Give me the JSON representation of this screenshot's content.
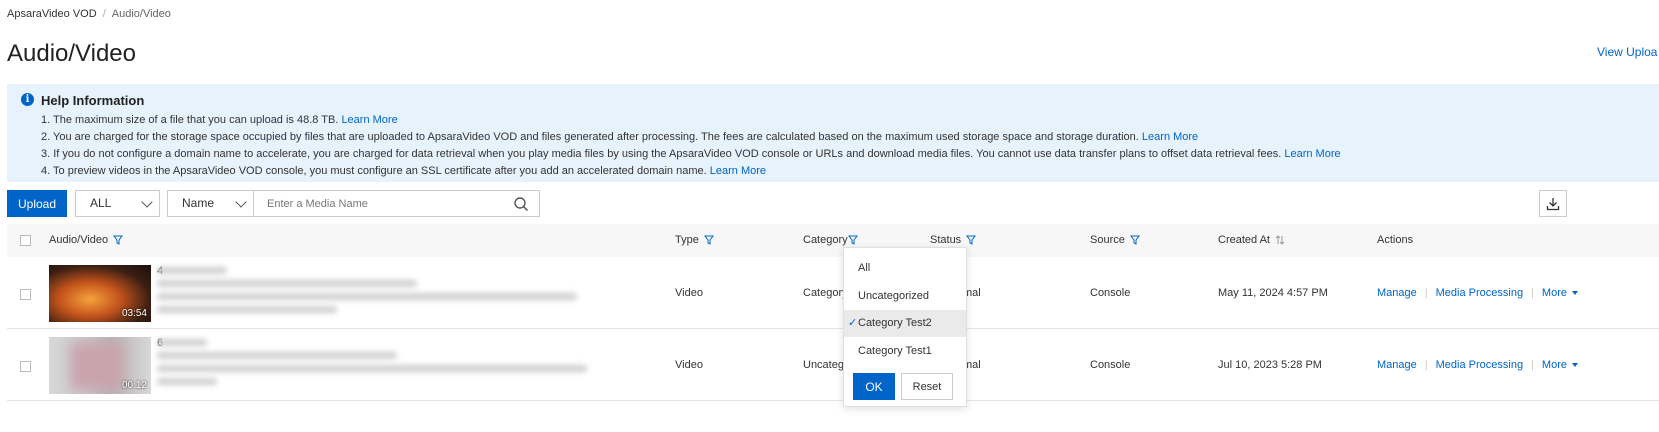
{
  "breadcrumb": {
    "root": "ApsaraVideo VOD",
    "current": "Audio/Video"
  },
  "page_title": "Audio/Video",
  "view_upload_label": "View Uploa",
  "help": {
    "title": "Help Information",
    "lines": [
      {
        "text": "1. The maximum size of a file that you can upload is 48.8 TB.",
        "link": "Learn More"
      },
      {
        "text": "2. You are charged for the storage space occupied by files that are uploaded to ApsaraVideo VOD and files generated after processing. The fees are calculated based on the maximum used storage space and storage duration.",
        "link": "Learn More"
      },
      {
        "text": "3. If you do not configure a domain name to accelerate, you are charged for data retrieval when you play media files by using the ApsaraVideo VOD console or URLs and download media files. You cannot use data transfer plans to offset data retrieval fees.",
        "link": "Learn More"
      },
      {
        "text": "4. To preview videos in the ApsaraVideo VOD console, you must configure an SSL certificate after you add an accelerated domain name.",
        "link": "Learn More"
      }
    ]
  },
  "toolbar": {
    "upload_label": "Upload",
    "type_select": "ALL",
    "field_select": "Name",
    "search_placeholder": "Enter a Media Name"
  },
  "table": {
    "headers": {
      "media": "Audio/Video",
      "type": "Type",
      "category": "Category",
      "status": "Status",
      "source": "Source",
      "created": "Created At",
      "actions": "Actions"
    },
    "rows": [
      {
        "duration": "03:54",
        "name_initial": "4",
        "type": "Video",
        "category": "Category",
        "status": "mal",
        "source": "Console",
        "created": "May 11, 2024 4:57 PM"
      },
      {
        "duration": "00:12",
        "name_initial": "6",
        "type": "Video",
        "category": "Uncateg",
        "status": "mal",
        "source": "Console",
        "created": "Jul 10, 2023 5:28 PM"
      }
    ],
    "actions": {
      "manage": "Manage",
      "media_processing": "Media Processing",
      "more": "More"
    }
  },
  "category_filter": {
    "options": [
      "All",
      "Uncategorized",
      "Category Test2",
      "Category Test1"
    ],
    "selected": "Category Test2",
    "ok_label": "OK",
    "reset_label": "Reset"
  },
  "colors": {
    "primary": "#0064c8",
    "help_bg": "#e6f3fc"
  }
}
